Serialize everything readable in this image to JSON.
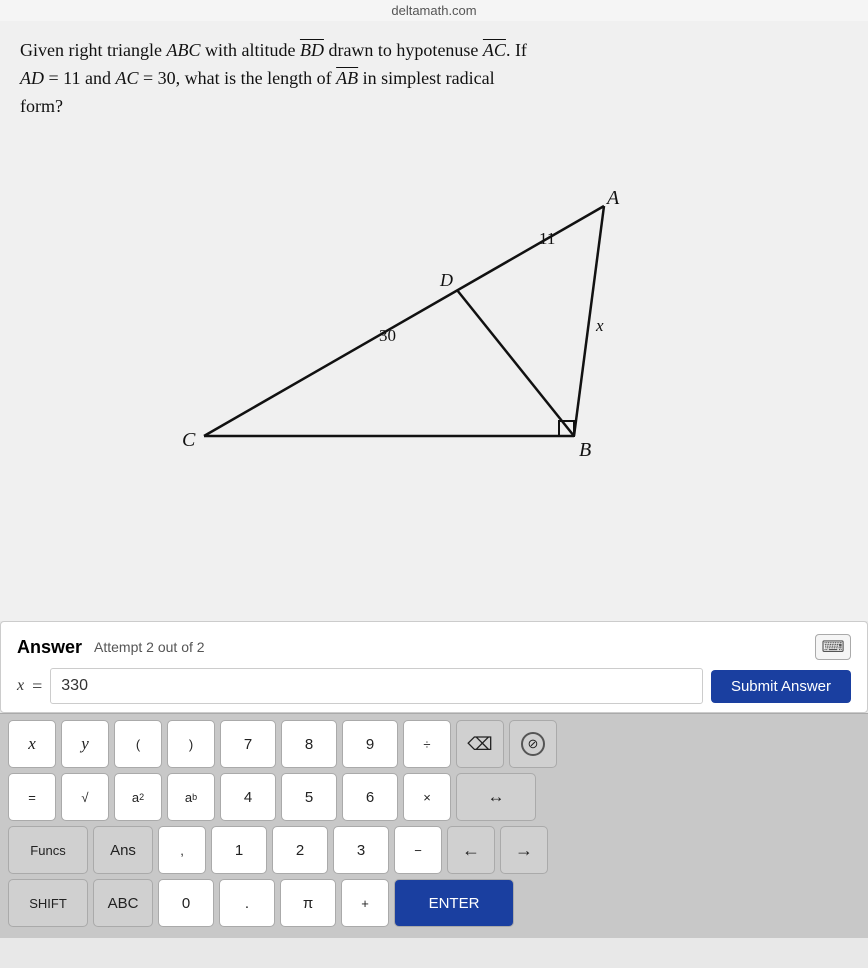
{
  "topbar": {
    "url": "deltamath.com"
  },
  "problem": {
    "line1": "Given right triangle ABC with altitude BD drawn to hypotenuse AC. If",
    "line2": "AD = 11 and AC = 30, what is the length of AB in simplest radical",
    "line3": "form?",
    "labels": {
      "A": "A",
      "B": "B",
      "C": "C",
      "D": "D",
      "x": "x",
      "11": "11",
      "30": "30"
    }
  },
  "answer": {
    "label": "Answer",
    "attempt": "Attempt 2 out of 2",
    "input_value": "330",
    "x_prefix": "x",
    "equals": "=",
    "submit_label": "Submit Answer"
  },
  "keyboard": {
    "row1": [
      {
        "label": "x",
        "type": "italic"
      },
      {
        "label": "y",
        "type": "italic"
      },
      {
        "label": "(",
        "type": "normal"
      },
      {
        "label": ")",
        "type": "normal"
      },
      {
        "label": "7",
        "type": "num"
      },
      {
        "label": "8",
        "type": "num"
      },
      {
        "label": "9",
        "type": "num"
      },
      {
        "label": "÷",
        "type": "normal"
      },
      {
        "label": "⌫",
        "type": "action"
      },
      {
        "label": "⊘",
        "type": "action"
      }
    ],
    "row2": [
      {
        "label": "=",
        "type": "normal"
      },
      {
        "label": "√",
        "type": "normal"
      },
      {
        "label": "a²",
        "type": "superscript"
      },
      {
        "label": "aᵇ",
        "type": "superscript"
      },
      {
        "label": "4",
        "type": "num"
      },
      {
        "label": "5",
        "type": "num"
      },
      {
        "label": "6",
        "type": "num"
      },
      {
        "label": "×",
        "type": "normal"
      },
      {
        "label": "↔",
        "type": "action"
      }
    ],
    "row3": [
      {
        "label": "Funcs",
        "type": "special"
      },
      {
        "label": "Ans",
        "type": "special"
      },
      {
        "label": ",",
        "type": "normal"
      },
      {
        "label": "1",
        "type": "num"
      },
      {
        "label": "2",
        "type": "num"
      },
      {
        "label": "3",
        "type": "num"
      },
      {
        "label": "−",
        "type": "normal"
      },
      {
        "label": "←",
        "type": "action"
      },
      {
        "label": "→",
        "type": "action"
      }
    ],
    "row4": [
      {
        "label": "SHIFT",
        "type": "special"
      },
      {
        "label": "ABC",
        "type": "special"
      },
      {
        "label": "0",
        "type": "num"
      },
      {
        "label": ".",
        "type": "num"
      },
      {
        "label": "π",
        "type": "num"
      },
      {
        "label": "+",
        "type": "normal"
      },
      {
        "label": "ENTER",
        "type": "blue"
      }
    ]
  }
}
